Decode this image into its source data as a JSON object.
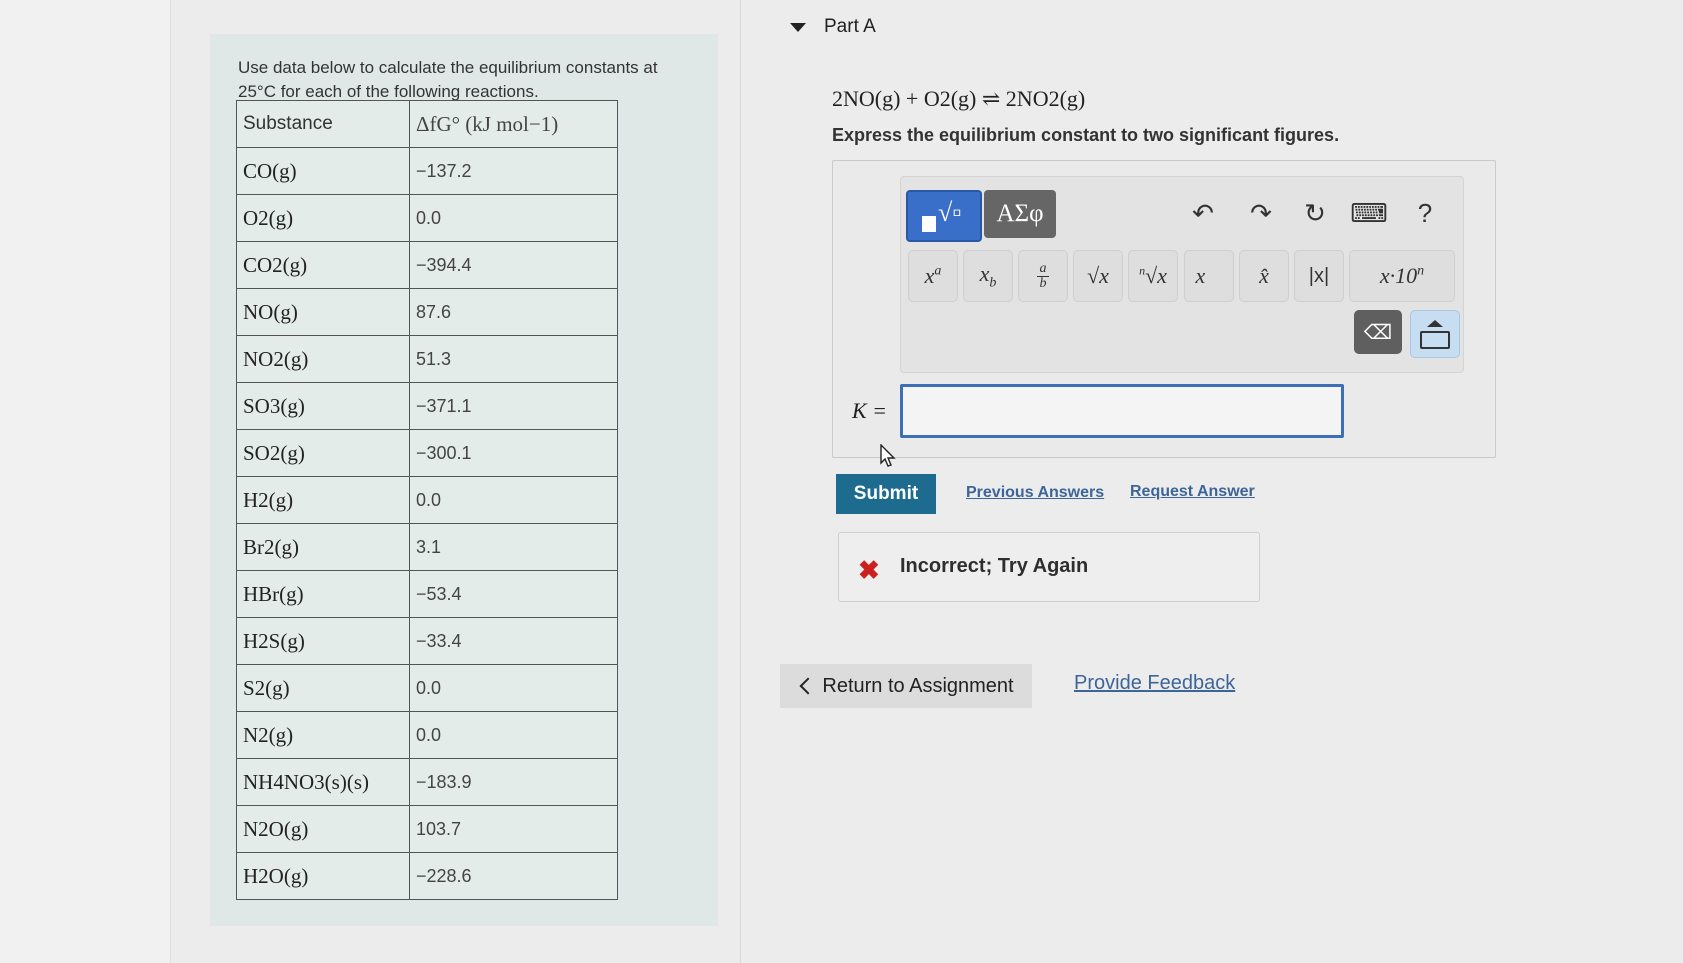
{
  "data_panel": {
    "intro": "Use data below to calculate the equilibrium constants at 25°C for each of the following reactions.",
    "table": {
      "headers": [
        "Substance",
        "ΔfG° (kJ mol−1)"
      ],
      "rows": [
        [
          "CO(g)",
          "−137.2"
        ],
        [
          "O2(g)",
          "0.0"
        ],
        [
          "CO2(g)",
          "−394.4"
        ],
        [
          "NO(g)",
          "87.6"
        ],
        [
          "NO2(g)",
          "51.3"
        ],
        [
          "SO3(g)",
          "−371.1"
        ],
        [
          "SO2(g)",
          "−300.1"
        ],
        [
          "H2(g)",
          "0.0"
        ],
        [
          "Br2(g)",
          "3.1"
        ],
        [
          "HBr(g)",
          "−53.4"
        ],
        [
          "H2S(g)",
          "−33.4"
        ],
        [
          "S2(g)",
          "0.0"
        ],
        [
          "N2(g)",
          "0.0"
        ],
        [
          "NH4NO3(s)(s)",
          "−183.9"
        ],
        [
          "N2O(g)",
          "103.7"
        ],
        [
          "H2O(g)",
          "−228.6"
        ]
      ]
    }
  },
  "part": {
    "title": "Part A",
    "equation": "2NO(g) + O2(g) ⇌ 2NO2(g)",
    "instructions": "Express the equilibrium constant to two significant figures."
  },
  "toolbar": {
    "templates_button": "▪√▫",
    "symbols_button": "ΑΣφ",
    "undo_icon": "↶",
    "redo_icon": "↷",
    "reset_icon": "↻",
    "keyboard_icon": "⌨",
    "help_label": "?",
    "templates": [
      "xa",
      "xb",
      "a/b",
      "√x",
      "n√x",
      "x→",
      "x̂",
      "|x|",
      "x·10n"
    ],
    "backspace_icon": "⌫"
  },
  "answer": {
    "label": "K =",
    "value": ""
  },
  "actions": {
    "submit_label": "Submit",
    "previous_answers": "Previous Answers",
    "request_answer": "Request Answer"
  },
  "feedback": {
    "icon": "✖",
    "message": "Incorrect; Try Again"
  },
  "footer": {
    "return_label": "Return to Assignment",
    "provide_feedback": "Provide Feedback"
  },
  "colors": {
    "accent_blue": "#3a6fc9",
    "submit_teal": "#1d6c8f",
    "error_red": "#cc2020",
    "link_blue": "#3d6598"
  }
}
